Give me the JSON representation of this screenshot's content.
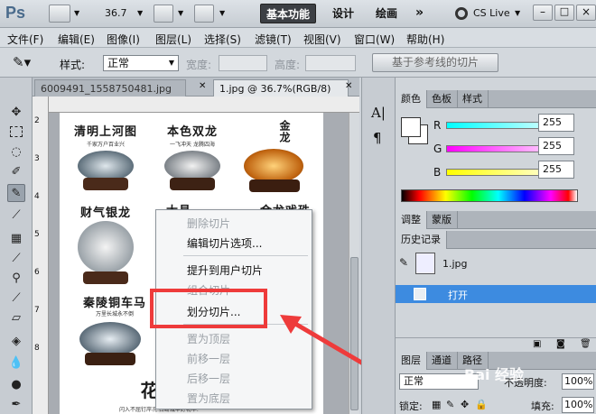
{
  "app": {
    "logo": "Ps",
    "zoom": "36.7",
    "cs_live": "CS Live"
  },
  "workspaces": [
    "基本功能",
    "设计",
    "绘画"
  ],
  "menu": [
    "文件(F)",
    "编辑(E)",
    "图像(I)",
    "图层(L)",
    "选择(S)",
    "滤镜(T)",
    "视图(V)",
    "窗口(W)",
    "帮助(H)"
  ],
  "options": {
    "style_label": "样式:",
    "style_value": "正常",
    "width_label": "宽度:",
    "height_label": "高度:",
    "guide_button": "基于参考线的切片"
  },
  "doc_tabs": [
    "6009491_1558750481.jpg",
    "1.jpg @ 36.7%(RGB/8)"
  ],
  "ruler_marks": [
    "2",
    "3",
    "4",
    "5",
    "6",
    "7",
    "8"
  ],
  "cells": [
    {
      "title": "清明上河图",
      "sub": "千家万户百业兴"
    },
    {
      "title": "本色双龙",
      "sub": "一飞冲天 龙腾四海"
    },
    {
      "title": "金龙",
      "sub": ""
    },
    {
      "title": "财气银龙",
      "sub": ""
    },
    {
      "title": "太昌",
      "sub": ""
    },
    {
      "title": "金龙戏珠",
      "sub": ""
    },
    {
      "title": "秦陵铜车马",
      "sub": "万里长城永不倒"
    },
    {
      "title": "花",
      "sub": ""
    }
  ],
  "doc_footer": "闪入不屈钉岸况.占断城中好物华.",
  "context_menu": {
    "items": [
      {
        "label": "删除切片",
        "enabled": false
      },
      {
        "label": "编辑切片选项...",
        "enabled": true
      },
      {
        "label": "提升到用户切片",
        "enabled": true
      },
      {
        "label": "组合切片",
        "enabled": false
      },
      {
        "label": "划分切片...",
        "enabled": true
      },
      {
        "label": "置为顶层",
        "enabled": false
      },
      {
        "label": "前移一层",
        "enabled": false
      },
      {
        "label": "后移一层",
        "enabled": false
      },
      {
        "label": "置为底层",
        "enabled": false
      }
    ]
  },
  "color_panel": {
    "tabs": [
      "颜色",
      "色板",
      "样式"
    ],
    "channels": [
      {
        "label": "R",
        "value": "255"
      },
      {
        "label": "G",
        "value": "255"
      },
      {
        "label": "B",
        "value": "255"
      }
    ]
  },
  "adjust_tabs": [
    "调整",
    "蒙版"
  ],
  "history": {
    "tab": "历史记录",
    "snapshot": "1.jpg",
    "step": "打开"
  },
  "layers": {
    "tabs": [
      "图层",
      "通道",
      "路径"
    ],
    "blend": "正常",
    "opacity_label": "不透明度:",
    "opacity": "100%",
    "lock_label": "锁定:",
    "fill_label": "填充:",
    "fill": "100%"
  },
  "watermark": "Bai 经验",
  "colors": {
    "accent": "#3a8ee6",
    "highlight": "#ee3b3b",
    "history_selected": "#3d8be0"
  }
}
